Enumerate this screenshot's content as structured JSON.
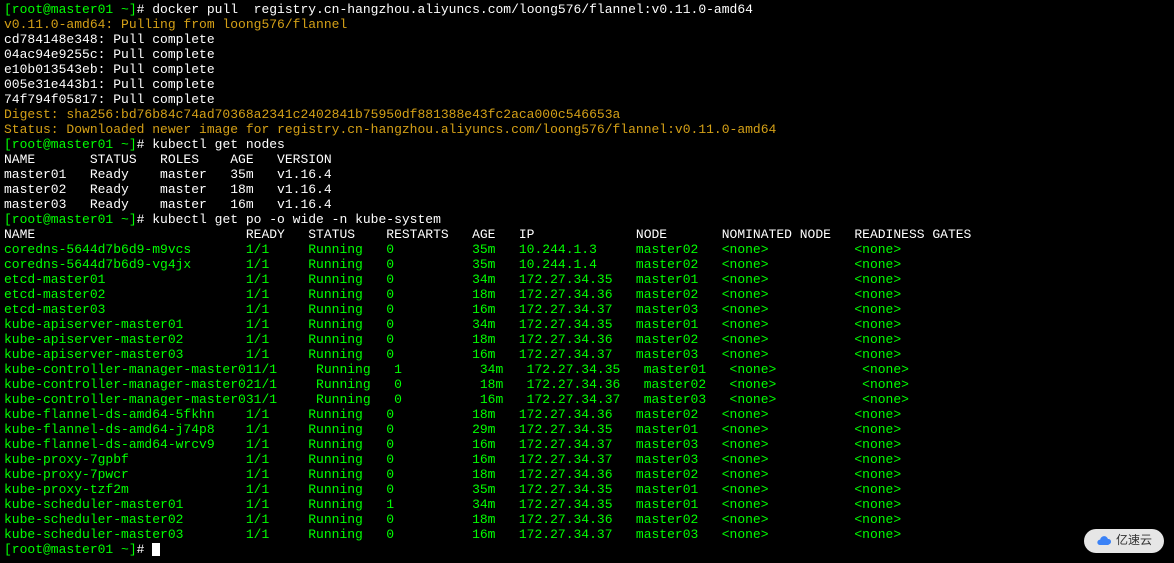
{
  "prompt_prefix": "[root@master01 ~]",
  "prompt_suffix": "# ",
  "commands": {
    "docker_pull": "docker pull  registry.cn-hangzhou.aliyuncs.com/loong576/flannel:v0.11.0-amd64",
    "get_nodes": "kubectl get nodes",
    "get_po": "kubectl get po -o wide -n kube-system"
  },
  "pull_output": {
    "pulling": "v0.11.0-amd64: Pulling from loong576/flannel",
    "layers": [
      "cd784148e348: Pull complete",
      "04ac94e9255c: Pull complete",
      "e10b013543eb: Pull complete",
      "005e31e443b1: Pull complete",
      "74f794f05817: Pull complete"
    ],
    "digest": "Digest: sha256:bd76b84c74ad70368a2341c2402841b75950df881388e43fc2aca000c546653a",
    "status": "Status: Downloaded newer image for registry.cn-hangzhou.aliyuncs.com/loong576/flannel:v0.11.0-amd64"
  },
  "nodes_header": "NAME       STATUS   ROLES    AGE   VERSION",
  "nodes": [
    "master01   Ready    master   35m   v1.16.4",
    "master02   Ready    master   18m   v1.16.4",
    "master03   Ready    master   16m   v1.16.4"
  ],
  "pods_header": "NAME                           READY   STATUS    RESTARTS   AGE   IP             NODE       NOMINATED NODE   READINESS GATES",
  "pods": [
    {
      "name": "coredns-5644d7b6d9-m9vcs",
      "ready": "1/1",
      "status": "Running",
      "restarts": "0",
      "age": "35m",
      "ip": "10.244.1.3",
      "node": "master02",
      "nom": "<none>",
      "rg": "<none>"
    },
    {
      "name": "coredns-5644d7b6d9-vg4jx",
      "ready": "1/1",
      "status": "Running",
      "restarts": "0",
      "age": "35m",
      "ip": "10.244.1.4",
      "node": "master02",
      "nom": "<none>",
      "rg": "<none>"
    },
    {
      "name": "etcd-master01",
      "ready": "1/1",
      "status": "Running",
      "restarts": "0",
      "age": "34m",
      "ip": "172.27.34.35",
      "node": "master01",
      "nom": "<none>",
      "rg": "<none>"
    },
    {
      "name": "etcd-master02",
      "ready": "1/1",
      "status": "Running",
      "restarts": "0",
      "age": "18m",
      "ip": "172.27.34.36",
      "node": "master02",
      "nom": "<none>",
      "rg": "<none>"
    },
    {
      "name": "etcd-master03",
      "ready": "1/1",
      "status": "Running",
      "restarts": "0",
      "age": "16m",
      "ip": "172.27.34.37",
      "node": "master03",
      "nom": "<none>",
      "rg": "<none>"
    },
    {
      "name": "kube-apiserver-master01",
      "ready": "1/1",
      "status": "Running",
      "restarts": "0",
      "age": "34m",
      "ip": "172.27.34.35",
      "node": "master01",
      "nom": "<none>",
      "rg": "<none>"
    },
    {
      "name": "kube-apiserver-master02",
      "ready": "1/1",
      "status": "Running",
      "restarts": "0",
      "age": "18m",
      "ip": "172.27.34.36",
      "node": "master02",
      "nom": "<none>",
      "rg": "<none>"
    },
    {
      "name": "kube-apiserver-master03",
      "ready": "1/1",
      "status": "Running",
      "restarts": "0",
      "age": "16m",
      "ip": "172.27.34.37",
      "node": "master03",
      "nom": "<none>",
      "rg": "<none>"
    },
    {
      "name": "kube-controller-manager-master01",
      "ready": "1/1",
      "status": "Running",
      "restarts": "1",
      "age": "34m",
      "ip": "172.27.34.35",
      "node": "master01",
      "nom": "<none>",
      "rg": "<none>"
    },
    {
      "name": "kube-controller-manager-master02",
      "ready": "1/1",
      "status": "Running",
      "restarts": "0",
      "age": "18m",
      "ip": "172.27.34.36",
      "node": "master02",
      "nom": "<none>",
      "rg": "<none>"
    },
    {
      "name": "kube-controller-manager-master03",
      "ready": "1/1",
      "status": "Running",
      "restarts": "0",
      "age": "16m",
      "ip": "172.27.34.37",
      "node": "master03",
      "nom": "<none>",
      "rg": "<none>"
    },
    {
      "name": "kube-flannel-ds-amd64-5fkhn",
      "ready": "1/1",
      "status": "Running",
      "restarts": "0",
      "age": "18m",
      "ip": "172.27.34.36",
      "node": "master02",
      "nom": "<none>",
      "rg": "<none>"
    },
    {
      "name": "kube-flannel-ds-amd64-j74p8",
      "ready": "1/1",
      "status": "Running",
      "restarts": "0",
      "age": "29m",
      "ip": "172.27.34.35",
      "node": "master01",
      "nom": "<none>",
      "rg": "<none>"
    },
    {
      "name": "kube-flannel-ds-amd64-wrcv9",
      "ready": "1/1",
      "status": "Running",
      "restarts": "0",
      "age": "16m",
      "ip": "172.27.34.37",
      "node": "master03",
      "nom": "<none>",
      "rg": "<none>"
    },
    {
      "name": "kube-proxy-7gpbf",
      "ready": "1/1",
      "status": "Running",
      "restarts": "0",
      "age": "16m",
      "ip": "172.27.34.37",
      "node": "master03",
      "nom": "<none>",
      "rg": "<none>"
    },
    {
      "name": "kube-proxy-7pwcr",
      "ready": "1/1",
      "status": "Running",
      "restarts": "0",
      "age": "18m",
      "ip": "172.27.34.36",
      "node": "master02",
      "nom": "<none>",
      "rg": "<none>"
    },
    {
      "name": "kube-proxy-tzf2m",
      "ready": "1/1",
      "status": "Running",
      "restarts": "0",
      "age": "35m",
      "ip": "172.27.34.35",
      "node": "master01",
      "nom": "<none>",
      "rg": "<none>"
    },
    {
      "name": "kube-scheduler-master01",
      "ready": "1/1",
      "status": "Running",
      "restarts": "1",
      "age": "34m",
      "ip": "172.27.34.35",
      "node": "master01",
      "nom": "<none>",
      "rg": "<none>"
    },
    {
      "name": "kube-scheduler-master02",
      "ready": "1/1",
      "status": "Running",
      "restarts": "0",
      "age": "18m",
      "ip": "172.27.34.36",
      "node": "master02",
      "nom": "<none>",
      "rg": "<none>"
    },
    {
      "name": "kube-scheduler-master03",
      "ready": "1/1",
      "status": "Running",
      "restarts": "0",
      "age": "16m",
      "ip": "172.27.34.37",
      "node": "master03",
      "nom": "<none>",
      "rg": "<none>"
    }
  ],
  "watermark": "亿速云"
}
